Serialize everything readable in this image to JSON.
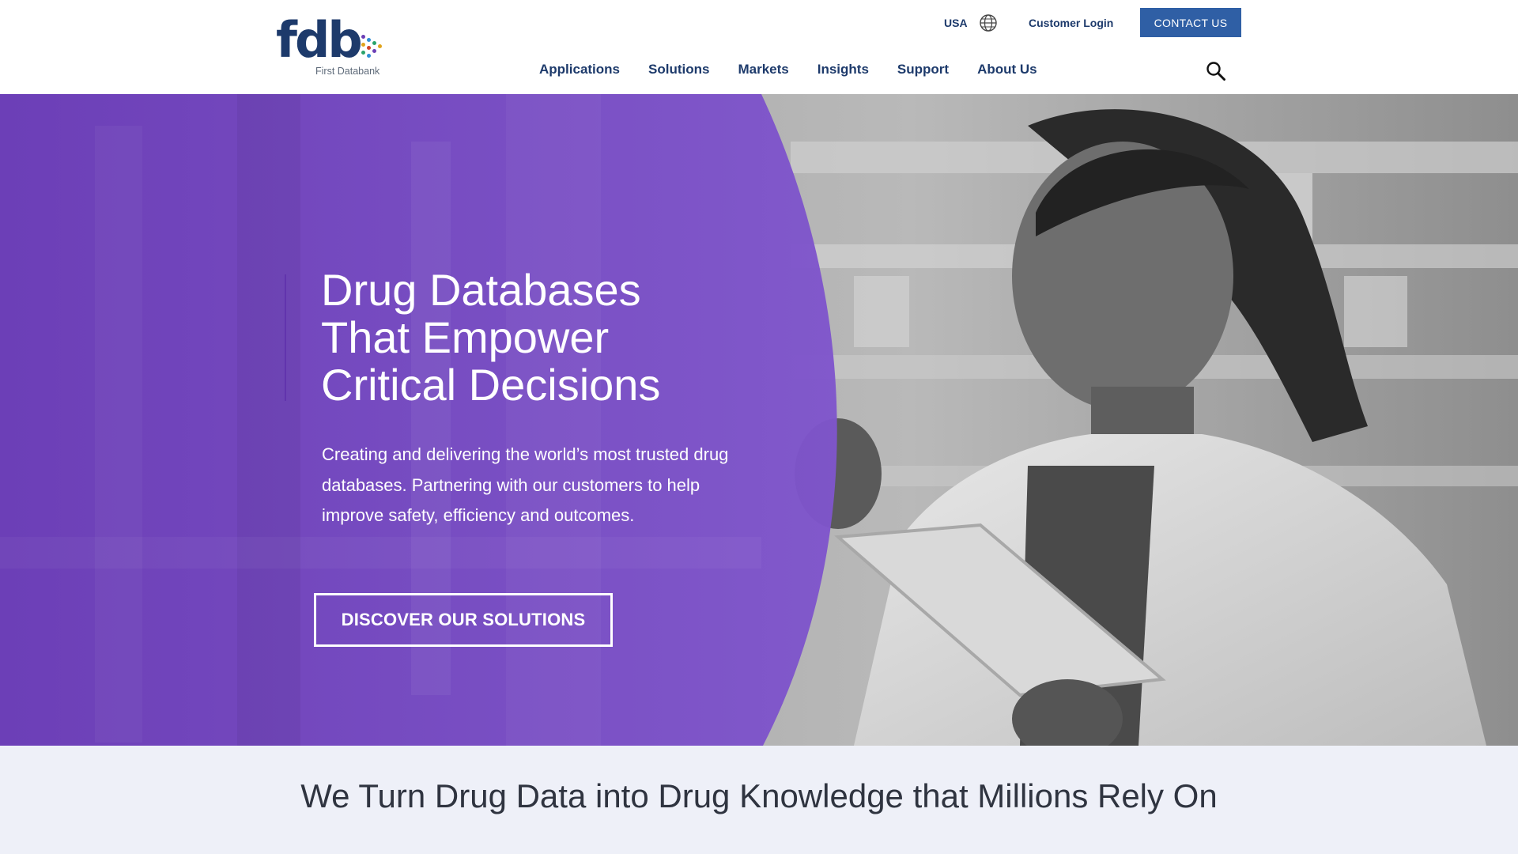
{
  "brand": {
    "logo_text": "fdb",
    "logo_subtitle": "First Databank",
    "logo_dot_colors": [
      "#6b3fb5",
      "#2f8fd6",
      "#2aa36b",
      "#e0a31b",
      "#d1432a"
    ]
  },
  "utility": {
    "country": "USA",
    "country_icon": "globe-icon",
    "login": "Customer Login",
    "contact": "CONTACT US"
  },
  "nav": {
    "items": [
      "Applications",
      "Solutions",
      "Markets",
      "Insights",
      "Support",
      "About Us"
    ],
    "search_icon": "search-icon"
  },
  "hero": {
    "title_lines": [
      "Drug Databases",
      "That Empower",
      "Critical Decisions"
    ],
    "body": "Creating and delivering the world’s most trusted drug databases. Partnering with our customers to help improve safety, efficiency and outcomes.",
    "cta": "DISCOVER OUR SOLUTIONS",
    "overlay_color": "#7b4fc9"
  },
  "band": {
    "text": "We Turn Drug Data into Drug Knowledge that Millions Rely On"
  },
  "colors": {
    "navy": "#1d3a6b",
    "button_blue": "#2f5fa5",
    "band_bg": "#eef0f8"
  }
}
